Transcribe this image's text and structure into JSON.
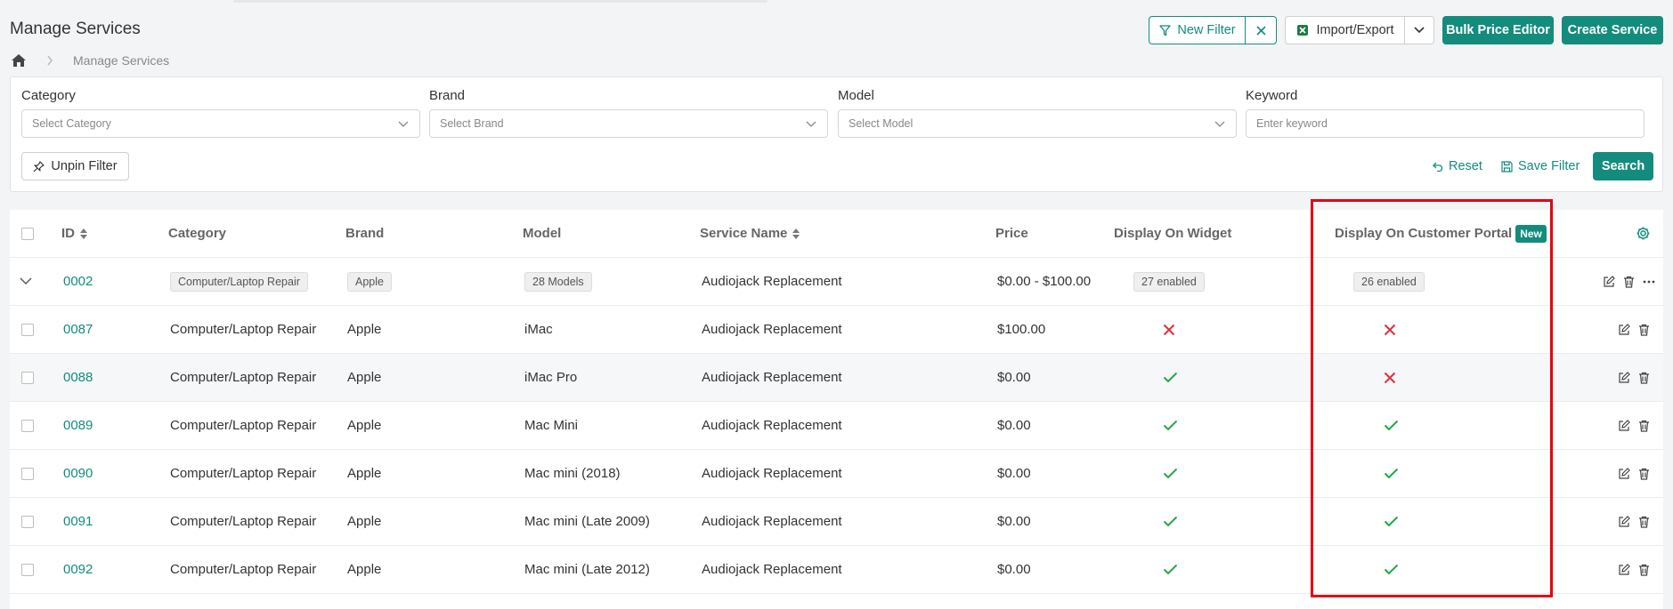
{
  "page": {
    "title": "Manage Services",
    "breadcrumb": {
      "current": "Manage Services"
    }
  },
  "toolbar": {
    "new_filter": "New Filter",
    "import_export": "Import/Export",
    "bulk_price_editor": "Bulk Price Editor",
    "create_service": "Create Service"
  },
  "filters": {
    "category": {
      "label": "Category",
      "placeholder": "Select Category"
    },
    "brand": {
      "label": "Brand",
      "placeholder": "Select Brand"
    },
    "model": {
      "label": "Model",
      "placeholder": "Select Model"
    },
    "keyword": {
      "label": "Keyword",
      "placeholder": "Enter keyword"
    },
    "unpin": "Unpin Filter",
    "reset": "Reset",
    "save_filter": "Save Filter",
    "search": "Search"
  },
  "table": {
    "headers": {
      "id": "ID",
      "category": "Category",
      "brand": "Brand",
      "model": "Model",
      "service_name": "Service Name",
      "price": "Price",
      "display_widget": "Display On Widget",
      "display_portal": "Display On Customer Portal",
      "new_badge": "New"
    },
    "group_row": {
      "id": "0002",
      "category": "Computer/Laptop Repair",
      "brand": "Apple",
      "model": "28 Models",
      "service_name": "Audiojack Replacement",
      "price": "$0.00 - $100.00",
      "widget": "27 enabled",
      "portal": "26 enabled"
    },
    "rows": [
      {
        "id": "0087",
        "category": "Computer/Laptop Repair",
        "brand": "Apple",
        "model": "iMac",
        "service_name": "Audiojack Replacement",
        "price": "$100.00",
        "widget": false,
        "portal": false
      },
      {
        "id": "0088",
        "category": "Computer/Laptop Repair",
        "brand": "Apple",
        "model": "iMac Pro",
        "service_name": "Audiojack Replacement",
        "price": "$0.00",
        "widget": true,
        "portal": false
      },
      {
        "id": "0089",
        "category": "Computer/Laptop Repair",
        "brand": "Apple",
        "model": "Mac Mini",
        "service_name": "Audiojack Replacement",
        "price": "$0.00",
        "widget": true,
        "portal": true
      },
      {
        "id": "0090",
        "category": "Computer/Laptop Repair",
        "brand": "Apple",
        "model": "Mac mini (2018)",
        "service_name": "Audiojack Replacement",
        "price": "$0.00",
        "widget": true,
        "portal": true
      },
      {
        "id": "0091",
        "category": "Computer/Laptop Repair",
        "brand": "Apple",
        "model": "Mac mini (Late 2009)",
        "service_name": "Audiojack Replacement",
        "price": "$0.00",
        "widget": true,
        "portal": true
      },
      {
        "id": "0092",
        "category": "Computer/Laptop Repair",
        "brand": "Apple",
        "model": "Mac mini (Late 2012)",
        "service_name": "Audiojack Replacement",
        "price": "$0.00",
        "widget": true,
        "portal": true
      }
    ]
  },
  "colors": {
    "accent": "#148c7d",
    "check": "#22a84a",
    "cross": "#e0303a",
    "highlight": "#e60012"
  }
}
